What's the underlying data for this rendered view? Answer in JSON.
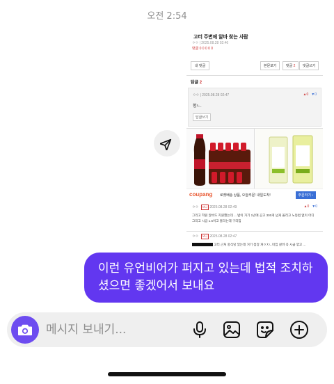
{
  "status": {
    "time": "오전 2:54"
  },
  "shared_image": {
    "post_title": "고터 주변에 알바 찾는 사람",
    "post_meta_line1": "ㅇㅇ | 2025.08.28 02:46",
    "post_meta_line2": "댓글 0 0 0 0 0",
    "my_replies_label": "내 댓글",
    "view_post_label": "본문보기",
    "reply_label": "댓글",
    "reply_count": "2",
    "write_reply_label": "댓글쓰기",
    "reply_header_label": "답글",
    "reply_header_count": "2",
    "comment1": {
      "meta": "ㅇㅇ | 2025.08.28 02:47",
      "likes": "0",
      "dislikes": "0",
      "text": "헝ㄴ.",
      "reply_btn": "답글쓰기"
    },
    "ad": {
      "brand": "coupang",
      "text": "로켓배송 상품, 오늘주문! 내일도착!",
      "order_btn": "주문하기 ›"
    },
    "comment2": {
      "nick": "ㅇㅇ",
      "badge": "쓰니",
      "meta": "2025.08.28 02:49",
      "likes": "0",
      "dislikes": "0",
      "text": "그리고 학원 알바도 지원했는데 ... 밥이 거기 1년에 공고 300개 넘게 올리고 노동법 없이 어디 그리고 시급 1.5이고 올리는데 구리임"
    },
    "comment3": {
      "nick": "ㅇㅇ",
      "badge": "쓰니",
      "meta": "2025.08.28 02:47",
      "text": "고터 근처 중식당 있는데 거기 점장 개ㅇㅊㄴ미임 걸려 꼭 시급 깎고 ..."
    }
  },
  "message": {
    "text": "이런 유언비어가 퍼지고 있는데 법적 조치하셨으면 좋겠어서 보내요"
  },
  "composer": {
    "placeholder": "메시지 보내기...",
    "icons": [
      "camera-icon",
      "microphone-icon",
      "image-icon",
      "sticker-icon",
      "plus-icon"
    ]
  },
  "colors": {
    "bubble": "#6237f0",
    "camera": "#6d4cf0",
    "composer_bg": "#efefef"
  }
}
